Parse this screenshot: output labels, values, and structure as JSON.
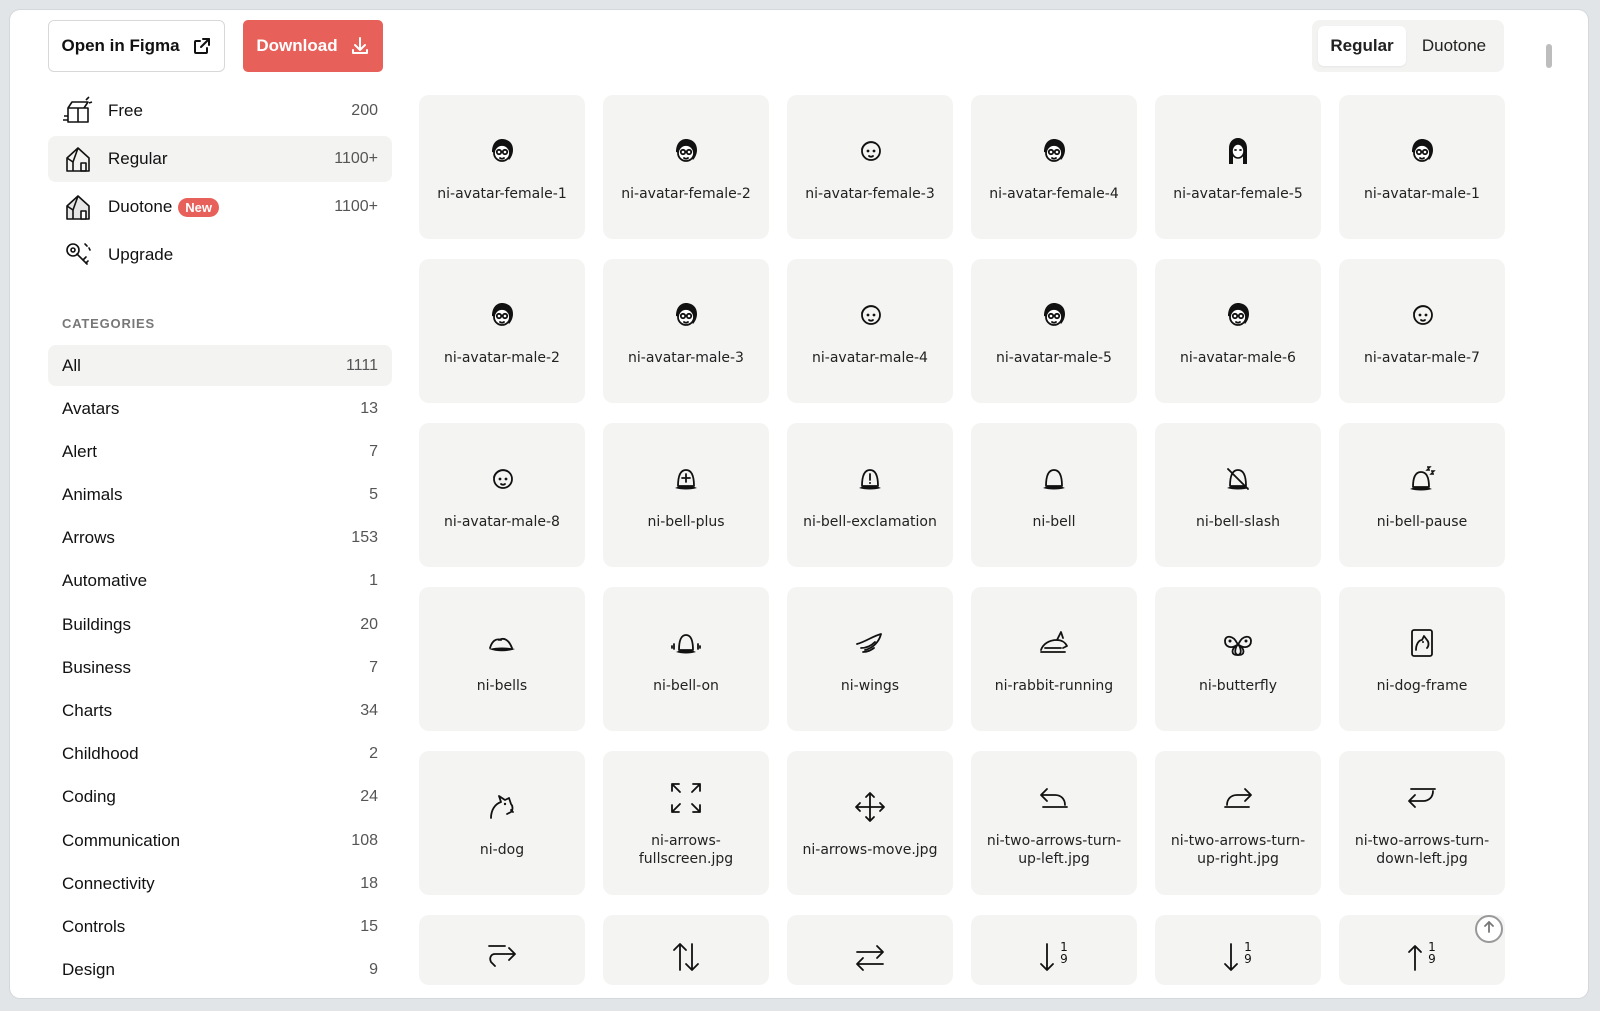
{
  "header": {
    "figma_label": "Open in Figma",
    "download_label": "Download",
    "style_toggle": {
      "options": [
        "Regular",
        "Duotone"
      ],
      "selected": "Regular"
    }
  },
  "sidebar": {
    "plans": [
      {
        "label": "Free",
        "count": "200",
        "icon": "box-icon",
        "active": false
      },
      {
        "label": "Regular",
        "count": "1100+",
        "icon": "house-icon",
        "active": true
      },
      {
        "label": "Duotone",
        "count": "1100+",
        "icon": "duotone-house-icon",
        "badge": "New",
        "active": false
      },
      {
        "label": "Upgrade",
        "count": "",
        "icon": "key-icon",
        "active": false
      }
    ],
    "categories_heading": "CATEGORIES",
    "categories": [
      {
        "label": "All",
        "count": "1111"
      },
      {
        "label": "Avatars",
        "count": "13"
      },
      {
        "label": "Alert",
        "count": "7"
      },
      {
        "label": "Animals",
        "count": "5"
      },
      {
        "label": "Arrows",
        "count": "153"
      },
      {
        "label": "Automative",
        "count": "1"
      },
      {
        "label": "Buildings",
        "count": "20"
      },
      {
        "label": "Business",
        "count": "7"
      },
      {
        "label": "Charts",
        "count": "34"
      },
      {
        "label": "Childhood",
        "count": "2"
      },
      {
        "label": "Coding",
        "count": "24"
      },
      {
        "label": "Communication",
        "count": "108"
      },
      {
        "label": "Connectivity",
        "count": "18"
      },
      {
        "label": "Controls",
        "count": "15"
      },
      {
        "label": "Design",
        "count": "9"
      }
    ],
    "active_category": "All"
  },
  "icons": [
    {
      "name": "ni-avatar-female-1",
      "icon": "avatar-icon"
    },
    {
      "name": "ni-avatar-female-2",
      "icon": "avatar-icon"
    },
    {
      "name": "ni-avatar-female-3",
      "icon": "avatar-outline-icon"
    },
    {
      "name": "ni-avatar-female-4",
      "icon": "avatar-icon"
    },
    {
      "name": "ni-avatar-female-5",
      "icon": "avatar-long-hair-icon"
    },
    {
      "name": "ni-avatar-male-1",
      "icon": "avatar-icon"
    },
    {
      "name": "ni-avatar-male-2",
      "icon": "avatar-icon"
    },
    {
      "name": "ni-avatar-male-3",
      "icon": "avatar-icon"
    },
    {
      "name": "ni-avatar-male-4",
      "icon": "avatar-outline-icon"
    },
    {
      "name": "ni-avatar-male-5",
      "icon": "avatar-icon"
    },
    {
      "name": "ni-avatar-male-6",
      "icon": "avatar-icon"
    },
    {
      "name": "ni-avatar-male-7",
      "icon": "avatar-outline-icon"
    },
    {
      "name": "ni-avatar-male-8",
      "icon": "avatar-outline-icon"
    },
    {
      "name": "ni-bell-plus",
      "icon": "bell-plus-icon"
    },
    {
      "name": "ni-bell-exclamation",
      "icon": "bell-exclamation-icon"
    },
    {
      "name": "ni-bell",
      "icon": "bell-icon"
    },
    {
      "name": "ni-bell-slash",
      "icon": "bell-slash-icon"
    },
    {
      "name": "ni-bell-pause",
      "icon": "bell-pause-icon"
    },
    {
      "name": "ni-bells",
      "icon": "bells-icon"
    },
    {
      "name": "ni-bell-on",
      "icon": "bell-on-icon"
    },
    {
      "name": "ni-wings",
      "icon": "wings-icon"
    },
    {
      "name": "ni-rabbit-running",
      "icon": "rabbit-icon"
    },
    {
      "name": "ni-butterfly",
      "icon": "butterfly-icon"
    },
    {
      "name": "ni-dog-frame",
      "icon": "dog-frame-icon"
    },
    {
      "name": "ni-dog",
      "icon": "dog-icon"
    },
    {
      "name": "ni-arrows-fullscreen.jpg",
      "icon": "arrows-fullscreen-icon"
    },
    {
      "name": "ni-arrows-move.jpg",
      "icon": "arrows-move-icon"
    },
    {
      "name": "ni-two-arrows-turn-up-left.jpg",
      "icon": "turn-up-left-icon"
    },
    {
      "name": "ni-two-arrows-turn-up-right.jpg",
      "icon": "turn-up-right-icon"
    },
    {
      "name": "ni-two-arrows-turn-down-left.jpg",
      "icon": "turn-down-left-icon"
    }
  ],
  "partial_icons": [
    {
      "icon": "turn-right-icon",
      "glyph": ""
    },
    {
      "icon": "arrows-up-down-icon",
      "glyph": ""
    },
    {
      "icon": "arrows-left-right-icon",
      "glyph": ""
    },
    {
      "icon": "sort-down-1-9-icon",
      "glyph": "1 9"
    },
    {
      "icon": "sort-down-1-9-alt-icon",
      "glyph": "1 9"
    },
    {
      "icon": "sort-up-1-9-icon",
      "glyph": "1 9"
    }
  ],
  "colors": {
    "accent": "#e8605a",
    "tile_bg": "#f4f4f3",
    "active_bg": "#f3f3f2"
  }
}
